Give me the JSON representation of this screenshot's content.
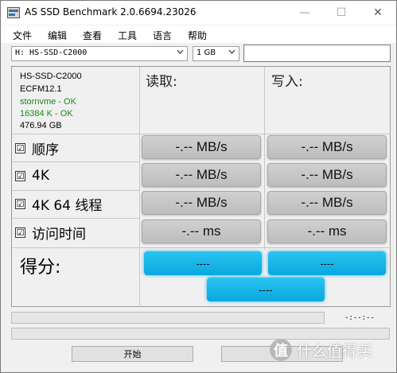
{
  "window": {
    "title": "AS SSD Benchmark 2.0.6694.23026",
    "minimize": "—",
    "maximize": "☐",
    "close": "✕"
  },
  "menu": [
    "文件",
    "编辑",
    "查看",
    "工具",
    "语言",
    "帮助"
  ],
  "drive_select": {
    "value": "H: HS-SSD-C2000"
  },
  "size_select": {
    "value": "1 GB"
  },
  "drive_info": {
    "name": "HS-SSD-C2000",
    "firmware": "ECFM12.1",
    "driver_status": "stornvme - OK",
    "alignment_status": "16384 K - OK",
    "capacity": "476.94 GB"
  },
  "headers": {
    "read": "读取:",
    "write": "写入:"
  },
  "rows": [
    {
      "label": "顺序",
      "checked": true,
      "read": "-.-- MB/s",
      "write": "-.-- MB/s"
    },
    {
      "label": "4K",
      "checked": true,
      "read": "-.-- MB/s",
      "write": "-.-- MB/s"
    },
    {
      "label": "4K 64 线程",
      "checked": true,
      "read": "-.-- MB/s",
      "write": "-.-- MB/s"
    },
    {
      "label": "访问时间",
      "checked": true,
      "read": "-.-- ms",
      "write": "-.-- ms"
    }
  ],
  "score": {
    "label": "得分:",
    "read": "----",
    "write": "----",
    "total": "----"
  },
  "progress": {
    "elapsed": "-:--:--"
  },
  "buttons": {
    "start": "开始",
    "abort": ""
  },
  "watermark": {
    "badge": "值",
    "text": "什么值得买"
  },
  "colors": {
    "score_accent": "#0aa8e0",
    "status_ok": "#1a8a1a"
  },
  "check_mark": "☑"
}
